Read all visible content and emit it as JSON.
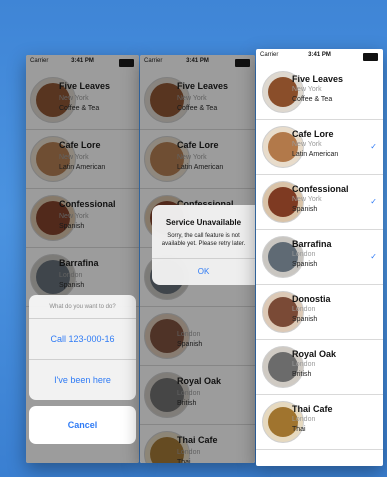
{
  "statusbar": {
    "carrier": "Carrier",
    "time": "3:41 PM"
  },
  "screen1": {
    "restaurants": [
      {
        "name": "Five Leaves",
        "location": "New York",
        "type": "Coffee & Tea",
        "color": "#8a4e2a"
      },
      {
        "name": "Cafe Lore",
        "location": "New York",
        "type": "Latin American",
        "color": "#b2794a"
      },
      {
        "name": "Confessional",
        "location": "New York",
        "type": "Spanish",
        "color": "#7e3a22"
      },
      {
        "name": "Barrafina",
        "location": "London",
        "type": "Spanish",
        "color": "#5f6a74"
      }
    ],
    "action_sheet": {
      "title": "What do you want to do?",
      "call": "Call 123-000-16",
      "been_here": "I've been here",
      "cancel": "Cancel"
    }
  },
  "screen2": {
    "restaurants": [
      {
        "name": "Five Leaves",
        "location": "New York",
        "type": "Coffee & Tea",
        "color": "#8a4e2a"
      },
      {
        "name": "Cafe Lore",
        "location": "New York",
        "type": "Latin American",
        "color": "#b2794a"
      },
      {
        "name": "Confessional",
        "location": "",
        "type": "",
        "color": "#7e3a22"
      },
      {
        "name": "",
        "location": "",
        "type": "",
        "color": "#5f6a74"
      },
      {
        "name": "",
        "location": "London",
        "type": "Spanish",
        "color": "#7a4a36"
      },
      {
        "name": "Royal Oak",
        "location": "London",
        "type": "British",
        "color": "#6b6b6b"
      },
      {
        "name": "Thai Cafe",
        "location": "London",
        "type": "Thai",
        "color": "#a0742e"
      }
    ],
    "alert": {
      "title": "Service Unavailable",
      "message": "Sorry, the call feature is not available yet. Please retry later.",
      "ok": "OK"
    }
  },
  "screen3": {
    "restaurants": [
      {
        "name": "Five Leaves",
        "location": "New York",
        "type": "Coffee & Tea",
        "checked": false,
        "color": "#8a4e2a"
      },
      {
        "name": "Cafe Lore",
        "location": "New York",
        "type": "Latin American",
        "checked": true,
        "color": "#b2794a"
      },
      {
        "name": "Confessional",
        "location": "New York",
        "type": "Spanish",
        "checked": true,
        "color": "#7e3a22"
      },
      {
        "name": "Barrafina",
        "location": "London",
        "type": "Spanish",
        "checked": true,
        "color": "#5f6a74"
      },
      {
        "name": "Donostia",
        "location": "London",
        "type": "Spanish",
        "checked": false,
        "color": "#7a4a36"
      },
      {
        "name": "Royal Oak",
        "location": "London",
        "type": "British",
        "checked": false,
        "color": "#6b6b6b"
      },
      {
        "name": "Thai Cafe",
        "location": "London",
        "type": "Thai",
        "checked": false,
        "color": "#a0742e"
      }
    ],
    "check_glyph": "✓"
  }
}
